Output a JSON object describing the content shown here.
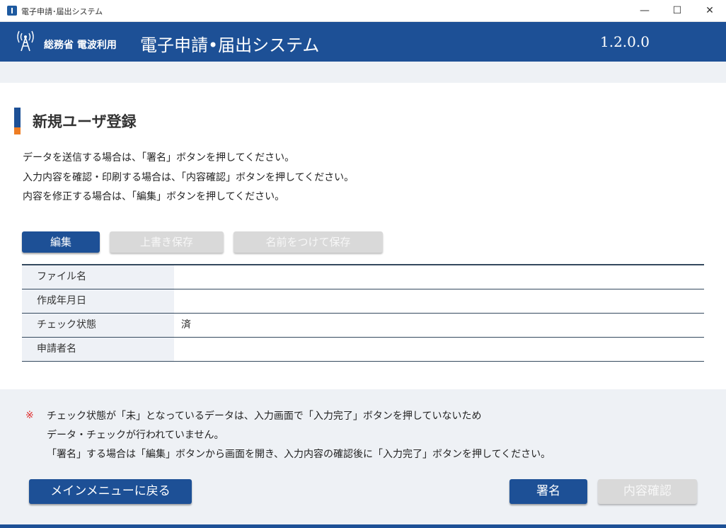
{
  "window": {
    "title": "電子申請･届出システム",
    "minimize": "—",
    "maximize": "☐",
    "close": "✕"
  },
  "header": {
    "org": "総務省 電波利用",
    "system_name": "電子申請•届出システム",
    "version": "1.2.0.0"
  },
  "page": {
    "title": "新規ユーザ登録",
    "instructions": [
      "データを送信する場合は、「署名」ボタンを押してください。",
      "入力内容を確認・印刷する場合は、「内容確認」ボタンを押してください。",
      "内容を修正する場合は、「編集」ボタンを押してください。"
    ]
  },
  "toolbar": {
    "edit": "編集",
    "overwrite_save": "上書き保存",
    "save_as": "名前をつけて保存"
  },
  "table": {
    "rows": [
      {
        "label": "ファイル名",
        "value": ""
      },
      {
        "label": "作成年月日",
        "value": ""
      },
      {
        "label": "チェック状態",
        "value": "済"
      },
      {
        "label": "申請者名",
        "value": ""
      }
    ]
  },
  "notes": {
    "mark": "※",
    "lines": [
      "チェック状態が「未」となっているデータは、入力画面で「入力完了」ボタンを押していないため",
      "データ・チェックが行われていません。",
      "「署名」する場合は「編集」ボタンから画面を開き、入力内容の確認後に「入力完了」ボタンを押してください。"
    ]
  },
  "footer": {
    "main_menu": "メインメニューに戻る",
    "sign": "署名",
    "confirm": "内容確認"
  },
  "colors": {
    "brand_blue": "#1d5096",
    "accent_orange": "#ee7d23",
    "note_red": "#e03030"
  }
}
